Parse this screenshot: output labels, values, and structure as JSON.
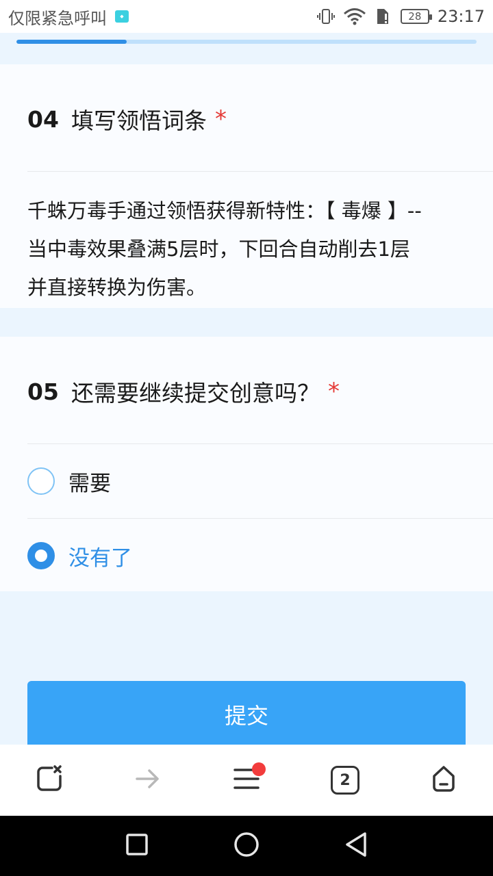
{
  "status_bar": {
    "carrier_text": "仅限紧急呼叫",
    "battery_level": "28",
    "time": "23:17"
  },
  "progress": {
    "fraction": 0.24
  },
  "question4": {
    "number": "04",
    "title": "填写领悟词条",
    "required_mark": "*",
    "answer_lines": [
      "千蛛万毒手通过领悟获得新特性：【 毒爆 】--",
      "当中毒效果叠满5层时，下回合自动削去1层",
      "并直接转换为伤害。"
    ]
  },
  "question5": {
    "number": "05",
    "title": "还需要继续提交创意吗？",
    "required_mark": "*",
    "options": [
      {
        "label": "需要",
        "selected": false
      },
      {
        "label": "没有了",
        "selected": true
      }
    ]
  },
  "submit": {
    "label": "提交"
  },
  "toolbar": {
    "tabs_count": "2",
    "icons": [
      "close-tab-icon",
      "forward-arrow-icon",
      "menu-icon",
      "tabs-icon",
      "home-icon"
    ],
    "menu_badge_color": "#f23c3c"
  },
  "nav_bar": {
    "icons": [
      "recent-apps-icon",
      "home-circle-icon",
      "back-triangle-icon"
    ]
  },
  "colors": {
    "accent": "#2f8fe6",
    "submit_bg": "#38a4f7",
    "required": "#e53935",
    "page_bg": "#ebf5fe"
  }
}
